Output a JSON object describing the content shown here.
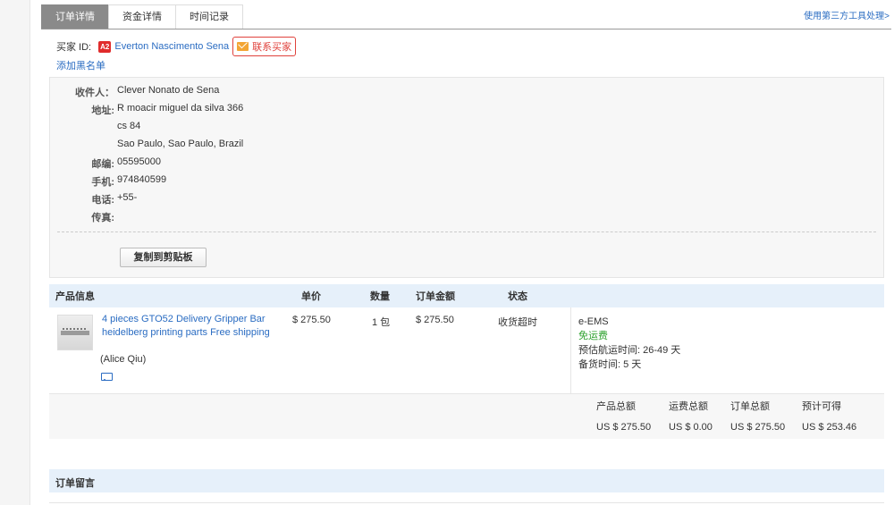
{
  "tabs": [
    {
      "label": "订单详情",
      "active": true
    },
    {
      "label": "资金详情",
      "active": false
    },
    {
      "label": "时间记录",
      "active": false
    }
  ],
  "third_party_link": "使用第三方工具处理>",
  "buyer": {
    "label": "买家 ID:",
    "badge": "A2",
    "name": "Everton Nascimento Sena",
    "contact_label": "联系买家",
    "blacklist_label": "添加黑名单"
  },
  "address": {
    "rows": [
      {
        "key": "收件人：",
        "value": "Clever Nonato de Sena"
      },
      {
        "key": "地址:",
        "value": "R moacir miguel da silva 366"
      },
      {
        "key": "",
        "value": "cs 84"
      },
      {
        "key": "",
        "value": "Sao Paulo, Sao Paulo, Brazil"
      },
      {
        "key": "邮编:",
        "value": "05595000"
      },
      {
        "key": "手机:",
        "value": "974840599"
      },
      {
        "key": "电话:",
        "value": "+55-"
      },
      {
        "key": "传真:",
        "value": ""
      }
    ],
    "copy_button": "复制到剪贴板"
  },
  "product_table": {
    "headers": {
      "product": "产品信息",
      "unit_price": "单价",
      "quantity": "数量",
      "order_amount": "订单金额",
      "status": "状态"
    },
    "row": {
      "title": "4 pieces GTO52 Delivery Gripper Bar heidelberg printing parts Free shipping",
      "seller": "(Alice Qiu)",
      "unit_price": "$ 275.50",
      "quantity": "1 包",
      "order_amount": "$ 275.50",
      "status": "收货超时",
      "shipping_method": "e-EMS",
      "shipping_fee": "免运费",
      "estimated_transit": "预估航运时间: 26-49 天",
      "stock_time": "备货时间: 5 天"
    }
  },
  "totals": {
    "labels": [
      "产品总额",
      "运费总额",
      "订单总额",
      "预计可得"
    ],
    "values": [
      "US $ 275.50",
      "US $ 0.00",
      "US $ 275.50",
      "US $ 253.46"
    ]
  },
  "message_section": {
    "title": "订单留言"
  },
  "colors": {
    "link": "#2a6cc2",
    "accent_red": "#e0423c",
    "free_green": "#2ea12e",
    "header_bg": "#e6f0fa"
  }
}
